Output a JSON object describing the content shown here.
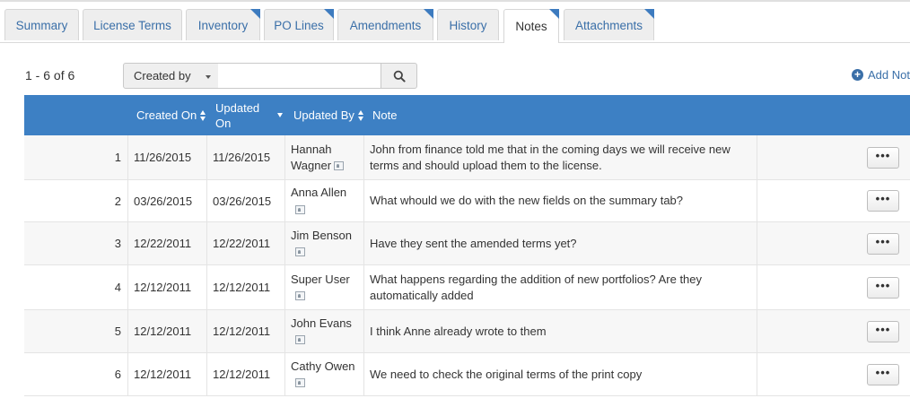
{
  "tabs": [
    {
      "label": "Summary",
      "corner": false,
      "active": false
    },
    {
      "label": "License Terms",
      "corner": false,
      "active": false
    },
    {
      "label": "Inventory",
      "corner": true,
      "active": false
    },
    {
      "label": "PO Lines",
      "corner": true,
      "active": false
    },
    {
      "label": "Amendments",
      "corner": true,
      "active": false
    },
    {
      "label": "History",
      "corner": false,
      "active": false
    },
    {
      "label": "Notes",
      "corner": true,
      "active": true
    },
    {
      "label": "Attachments",
      "corner": true,
      "active": false
    }
  ],
  "toolbar": {
    "count": "1 - 6 of 6",
    "filter_select": "Created by",
    "search_value": "",
    "add_note": "Add Note"
  },
  "columns": {
    "created_on": "Created On",
    "updated_on_line1": "Updated",
    "updated_on_line2": "On",
    "updated_by": "Updated By",
    "note": "Note"
  },
  "rows": [
    {
      "num": "1",
      "created": "11/26/2015",
      "updated": "11/26/2015",
      "by1": "Hannah",
      "by2": "Wagner",
      "note": "John from finance told me that in the coming days we will receive new terms and should upload them to the license.",
      "action": "•••"
    },
    {
      "num": "2",
      "created": "03/26/2015",
      "updated": "03/26/2015",
      "by1": "Anna Allen",
      "by2": "",
      "note": "What whould we do with the new fields on the summary tab?",
      "action": "•••"
    },
    {
      "num": "3",
      "created": "12/22/2011",
      "updated": "12/22/2011",
      "by1": "Jim Benson",
      "by2": "",
      "note": "Have they sent the amended terms yet?",
      "action": "•••"
    },
    {
      "num": "4",
      "created": "12/12/2011",
      "updated": "12/12/2011",
      "by1": "Super User",
      "by2": "",
      "note": "What happens regarding the addition of new portfolios? Are they automatically added",
      "action": "•••"
    },
    {
      "num": "5",
      "created": "12/12/2011",
      "updated": "12/12/2011",
      "by1": "John Evans",
      "by2": "",
      "note": "I think Anne already wrote to them",
      "action": "•••"
    },
    {
      "num": "6",
      "created": "12/12/2011",
      "updated": "12/12/2011",
      "by1": "Cathy Owen",
      "by2": "",
      "note": "We need to check the original terms of the print copy",
      "action": "•••"
    }
  ]
}
